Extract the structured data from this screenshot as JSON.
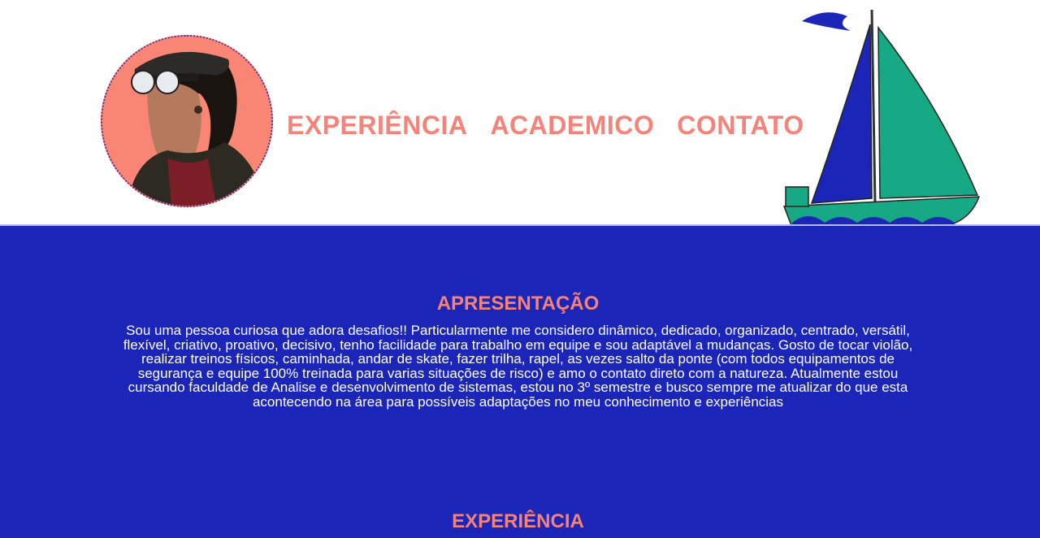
{
  "header": {
    "avatar_icon": "profile-photo",
    "boat_icon": "sailboat-illustration",
    "nav": [
      {
        "label": "EXPERIÊNCIA"
      },
      {
        "label": "ACADEMICO"
      },
      {
        "label": "CONTATO"
      }
    ]
  },
  "presentation": {
    "title": "APRESENTAÇÃO",
    "text": "Sou uma pessoa curiosa que adora desafios!! Particularmente me considero dinâmico, dedicado, organizado, centrado, versátil, flexível, criativo, proativo, decisivo, tenho facilidade para trabalho em equipe e sou adaptável a mudanças. Gosto de tocar violão, realizar treinos físicos, caminhada, andar de skate, fazer trilha, rapel, as vezes salto da ponte (com todos equipamentos de segurança e equipe 100% treinada para varias situações de risco) e amo o contato direto com a natureza. Atualmente estou cursando faculdade de Analise e desenvolvimento de sistemas, estou no 3º semestre e busco sempre me atualizar do que esta acontecendo na área para possíveis adaptações no meu conhecimento e experiências"
  },
  "experience": {
    "title": "EXPERIÊNCIA"
  },
  "colors": {
    "accent": "#f5837a",
    "main_bg": "#1b26b8",
    "header_bg": "#ffffff",
    "sail_blue": "#1b26b8",
    "sail_green": "#17a884"
  }
}
